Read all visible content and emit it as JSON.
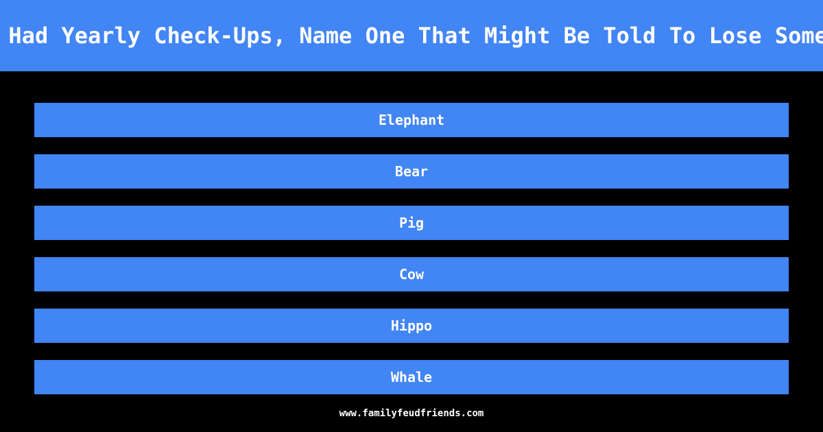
{
  "theme": {
    "background_color": "#000000",
    "accent_color": "#4285f4",
    "text_color": "#ffffff"
  },
  "header": {
    "question": "Animals Had Yearly Check-Ups, Name One That Might Be Told To Lose Some Weight"
  },
  "answers": [
    {
      "label": "Elephant"
    },
    {
      "label": "Bear"
    },
    {
      "label": "Pig"
    },
    {
      "label": "Cow"
    },
    {
      "label": "Hippo"
    },
    {
      "label": "Whale"
    }
  ],
  "footer": {
    "site": "www.familyfeudfriends.com"
  }
}
